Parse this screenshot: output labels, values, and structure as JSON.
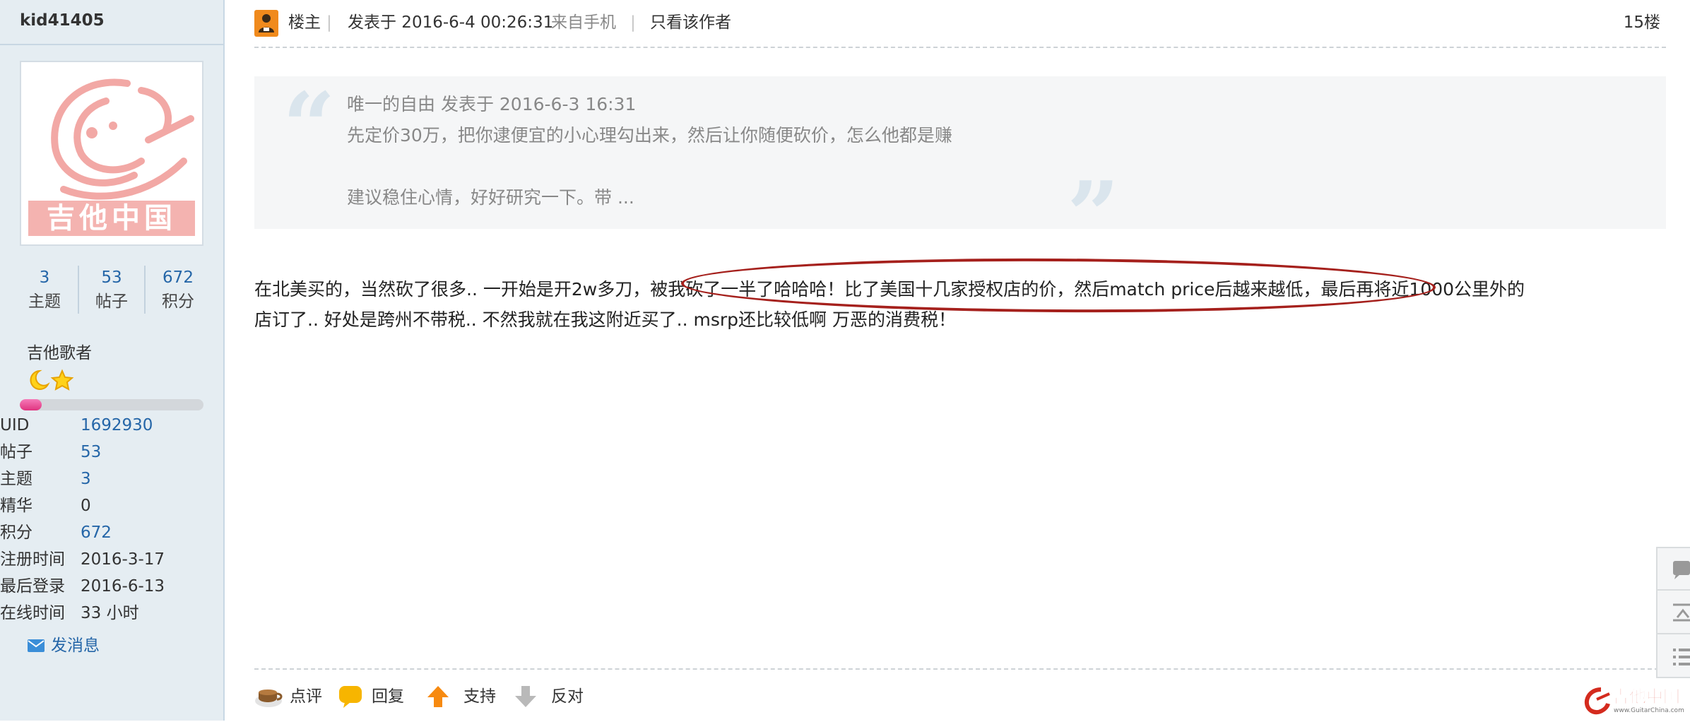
{
  "user": {
    "name": "kid41405",
    "avatar_text": "吉他中国",
    "stats": [
      {
        "num": "3",
        "label": "主题"
      },
      {
        "num": "53",
        "label": "帖子"
      },
      {
        "num": "672",
        "label": "积分"
      }
    ],
    "rank_title": "吉他歌者",
    "progress": 0.12,
    "info": [
      {
        "key": "UID",
        "value": "1692930",
        "link": true
      },
      {
        "key": "帖子",
        "value": "53",
        "link": true
      },
      {
        "key": "主题",
        "value": "3",
        "link": true
      },
      {
        "key": "精华",
        "value": "0",
        "link": false
      },
      {
        "key": "积分",
        "value": "672",
        "link": true
      },
      {
        "key": "注册时间",
        "value": "2016-3-17",
        "link": false
      },
      {
        "key": "最后登录",
        "value": "2016-6-13",
        "link": false
      },
      {
        "key": "在线时间",
        "value": "33 小时",
        "link": false
      }
    ],
    "send_message": "发消息"
  },
  "post": {
    "owner_label": "楼主",
    "posted_at": "发表于 2016-6-4 00:26:31",
    "source": "来自手机",
    "author_only": "只看该作者",
    "floor": "15楼",
    "quote": {
      "author_line": "唯一的自由 发表于 2016-6-3 16:31",
      "line1": "先定价30万，把你逮便宜的小心理勾出来，然后让你随便砍价，怎么他都是赚",
      "line2": "建议稳住心情，好好研究一下。带 ..."
    },
    "body_line1": "在北美买的，当然砍了很多.. 一开始是开2w多刀，被我砍了一半了哈哈哈！比了美国十几家授权店的价，然后match price后越来越低，最后再将近1000公里外的",
    "body_line2": "店订了.. 好处是跨州不带税.. 不然我就在我这附近买了.. msrp还比较低啊 万恶的消费税！"
  },
  "actions": {
    "comment": "点评",
    "reply": "回复",
    "support": "支持",
    "oppose": "反对"
  },
  "logo": {
    "text": "吉他中国",
    "sub": "www.GuitarChina.com"
  },
  "colors": {
    "link": "#2566a8",
    "accent": "#f08a1c",
    "circle": "#a5201c"
  }
}
